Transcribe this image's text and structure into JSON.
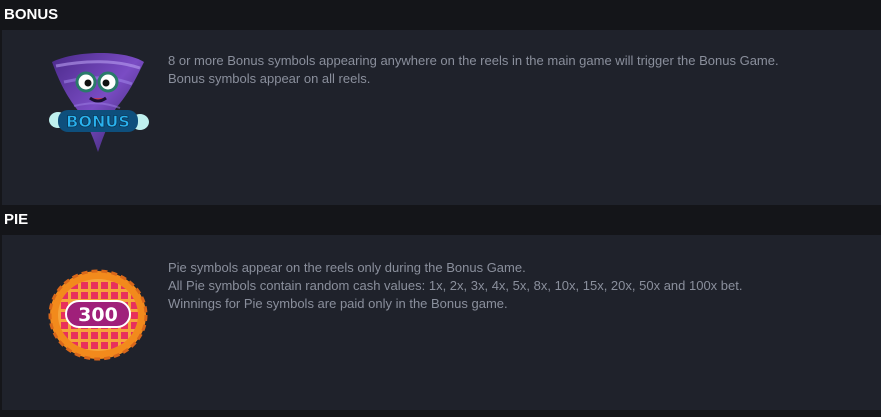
{
  "sections": [
    {
      "title": "BONUS",
      "symbol_label": "BONUS",
      "lines": [
        "8 or more Bonus symbols appearing anywhere on the reels in the main game will trigger the Bonus Game.",
        "Bonus symbols appear on all reels."
      ]
    },
    {
      "title": "PIE",
      "symbol_label": "300",
      "lines": [
        "Pie symbols appear on the reels only during the Bonus Game.",
        "All Pie symbols contain random cash values: 1x, 2x, 3x, 4x, 5x, 8x, 10x, 15x, 20x, 50x and 100x bet.",
        "Winnings for Pie symbols are paid only in the Bonus game."
      ]
    }
  ],
  "colors": {
    "background": "#15161a",
    "panel": "#1f222b",
    "title_text": "#ffffff",
    "body_text": "#8a8f9c",
    "bonus_blue": "#2ab3f0",
    "pie_crust": "#f28a1c",
    "pie_filling": "#e8305c",
    "pie_badge": "#a0207a"
  }
}
